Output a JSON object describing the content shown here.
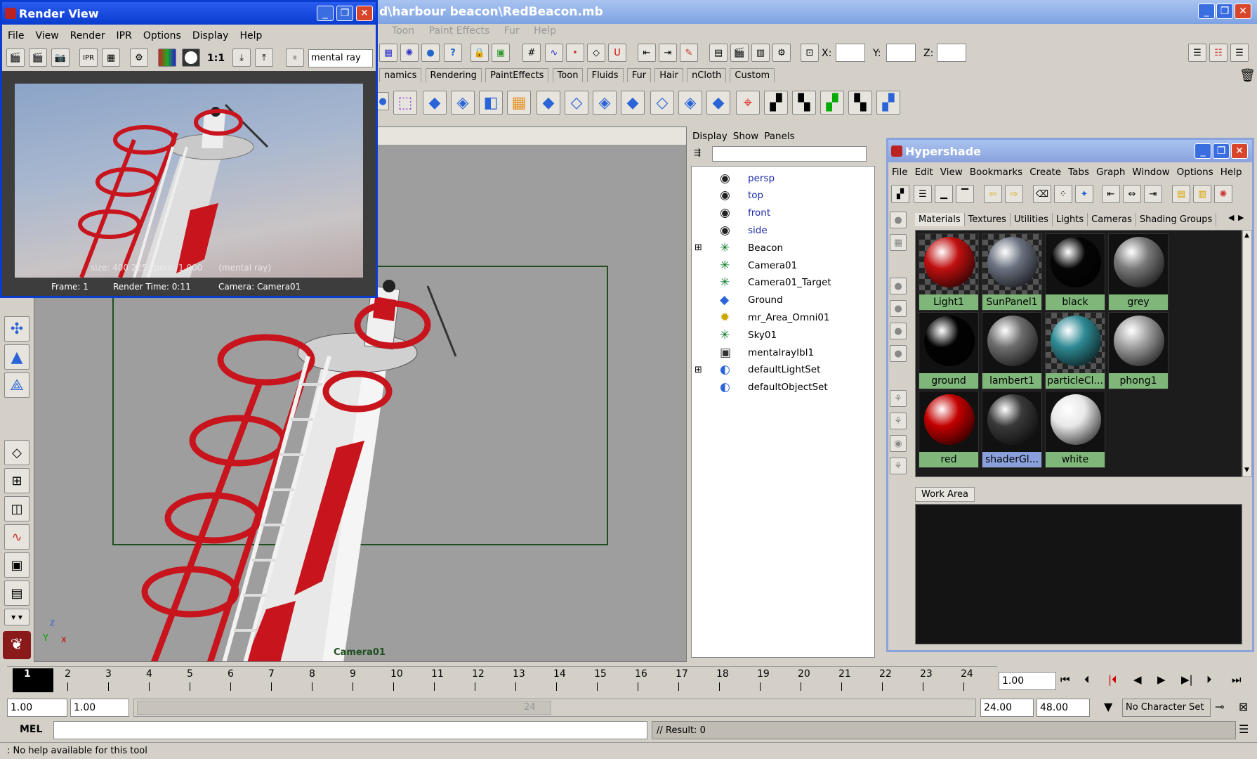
{
  "main_window": {
    "title": "d\\harbour beacon\\RedBeacon.mb",
    "menus": [
      "Toon",
      "Paint Effects",
      "Fur",
      "Help"
    ],
    "shelf_tabs": [
      "namics",
      "Rendering",
      "PaintEffects",
      "Toon",
      "Fluids",
      "Fur",
      "Hair",
      "nCloth",
      "Custom"
    ],
    "x_label": "X:",
    "y_label": "Y:",
    "z_label": "Z:"
  },
  "render_view": {
    "title": "Render View",
    "menus": [
      "File",
      "View",
      "Render",
      "IPR",
      "Options",
      "Display",
      "Help"
    ],
    "ratio_label": "1:1",
    "renderer": "mental ray",
    "info_line": "size: 400 225 zoom: 1.000      (mental ray)",
    "status": {
      "frame": "Frame: 1",
      "render_time": "Render Time: 0:11",
      "camera": "Camera: Camera01"
    }
  },
  "viewport": {
    "camera_label": "Camera01",
    "axis_z": "z",
    "axis_y": "Y",
    "axis_x": "x"
  },
  "outliner": {
    "menus": [
      "Display",
      "Show",
      "Panels"
    ],
    "items": [
      {
        "label": "persp",
        "type": "camera"
      },
      {
        "label": "top",
        "type": "camera"
      },
      {
        "label": "front",
        "type": "camera"
      },
      {
        "label": "side",
        "type": "camera"
      },
      {
        "label": "Beacon",
        "type": "group"
      },
      {
        "label": "Camera01",
        "type": "group"
      },
      {
        "label": "Camera01_Target",
        "type": "group"
      },
      {
        "label": "Ground",
        "type": "plane"
      },
      {
        "label": "mr_Area_Omni01",
        "type": "light"
      },
      {
        "label": "Sky01",
        "type": "group"
      },
      {
        "label": "mentalrayIbl1",
        "type": "ibl"
      },
      {
        "label": "defaultLightSet",
        "type": "set"
      },
      {
        "label": "defaultObjectSet",
        "type": "set"
      }
    ]
  },
  "hypershade": {
    "title": "Hypershade",
    "menus": [
      "File",
      "Edit",
      "View",
      "Bookmarks",
      "Create",
      "Tabs",
      "Graph",
      "Window",
      "Options",
      "Help"
    ],
    "tabs": [
      "Materials",
      "Textures",
      "Utilities",
      "Lights",
      "Cameras",
      "Shading Groups"
    ],
    "materials": [
      {
        "name": "Light1",
        "color": "#c01010"
      },
      {
        "name": "SunPanel1",
        "color": "#6b7280"
      },
      {
        "name": "black",
        "color": "#050505"
      },
      {
        "name": "grey",
        "color": "#7a7a7a"
      },
      {
        "name": "ground",
        "color": "#030303"
      },
      {
        "name": "lambert1",
        "color": "#6e6e6e"
      },
      {
        "name": "particleCl...",
        "color": "#2f8a94"
      },
      {
        "name": "phong1",
        "color": "#a0a0a0"
      },
      {
        "name": "red",
        "color": "#c40000"
      },
      {
        "name": "shaderGl...",
        "color": "#3a3a3a"
      },
      {
        "name": "white",
        "color": "#e8e8e8"
      }
    ],
    "work_area_label": "Work Area"
  },
  "timeline": {
    "ticks": [
      "1",
      "2",
      "3",
      "4",
      "5",
      "6",
      "7",
      "8",
      "9",
      "10",
      "11",
      "12",
      "13",
      "14",
      "15",
      "16",
      "17",
      "18",
      "19",
      "20",
      "21",
      "22",
      "23",
      "24"
    ],
    "current_frame": "1.00",
    "range_start": "1.00",
    "range_start2": "1.00",
    "range_mark": "24",
    "range_end": "24.00",
    "range_end2": "48.00",
    "character_set": "No Character Set"
  },
  "command_line": {
    "mel_label": "MEL",
    "result": "// Result: 0"
  },
  "help_line": {
    "text": ": No help available for this tool"
  },
  "colors": {
    "accent_title": "#0a3ccf",
    "viewport_bg": "#9e9e9e",
    "beacon_red": "#c8141c",
    "swatch_label": "#7fb77a"
  }
}
